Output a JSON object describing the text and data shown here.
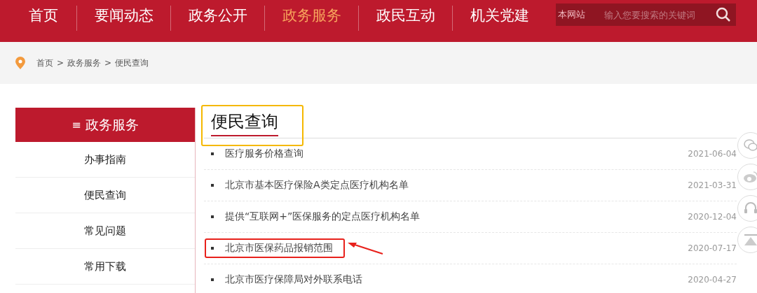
{
  "nav": {
    "items": [
      {
        "label": "首页",
        "selected": false
      },
      {
        "label": "要闻动态",
        "selected": false
      },
      {
        "label": "政务公开",
        "selected": false
      },
      {
        "label": "政务服务",
        "selected": true
      },
      {
        "label": "政民互动",
        "selected": false
      },
      {
        "label": "机关党建",
        "selected": false
      }
    ],
    "search": {
      "scope": "本网站",
      "placeholder": "输入您要搜索的关键词"
    }
  },
  "breadcrumb": [
    "首页",
    ">",
    "政务服务",
    ">",
    "便民查询"
  ],
  "sidebar": {
    "title": "政务服务",
    "menu_glyph": "≡",
    "items": [
      "办事指南",
      "便民查询",
      "常见问题",
      "常用下载"
    ]
  },
  "content": {
    "title": "便民查询",
    "title_highlighted": true,
    "rows": [
      {
        "title": "医疗服务价格查询",
        "date": "2021-06-04",
        "highlighted": false
      },
      {
        "title": "北京市基本医疗保险A类定点医疗机构名单",
        "date": "2021-03-31",
        "highlighted": false
      },
      {
        "title": "提供“互联网+”医保服务的定点医疗机构名单",
        "date": "2020-12-04",
        "highlighted": false
      },
      {
        "title": "北京市医保药品报销范围",
        "date": "2020-07-17",
        "highlighted": true
      },
      {
        "title": "北京市医疗保障局对外联系电话",
        "date": "2020-04-27",
        "highlighted": false
      }
    ]
  }
}
